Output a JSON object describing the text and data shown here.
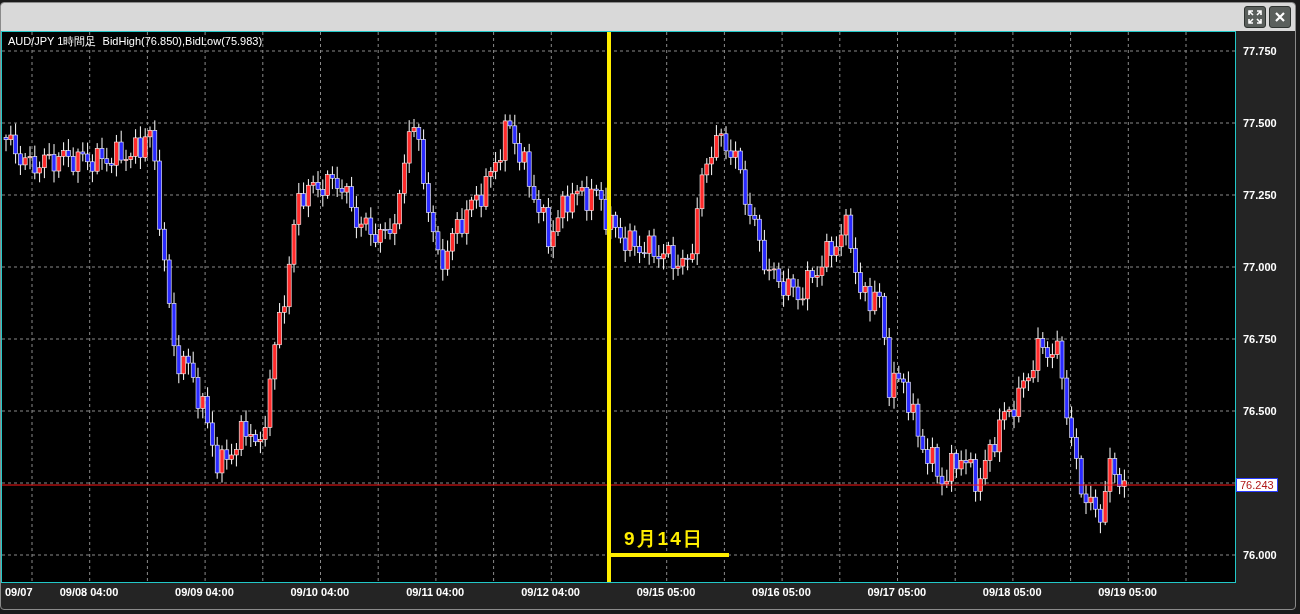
{
  "chart": {
    "title": "AUD/JPY 1時間足  BidHigh(76.850),BidLow(75.983)",
    "y_labels": [
      "77.750",
      "77.500",
      "77.250",
      "77.000",
      "76.750",
      "76.500",
      "76.000"
    ],
    "x_labels": [
      "09/07",
      "09/08 04:00",
      "09/09 04:00",
      "09/10 04:00",
      "09/11 04:00",
      "09/12 04:00",
      "09/15 05:00",
      "09/16 05:00",
      "09/17 05:00",
      "09/18 05:00",
      "09/19 05:00"
    ],
    "current_price": "76.243",
    "annotation": "9月14日"
  }
}
